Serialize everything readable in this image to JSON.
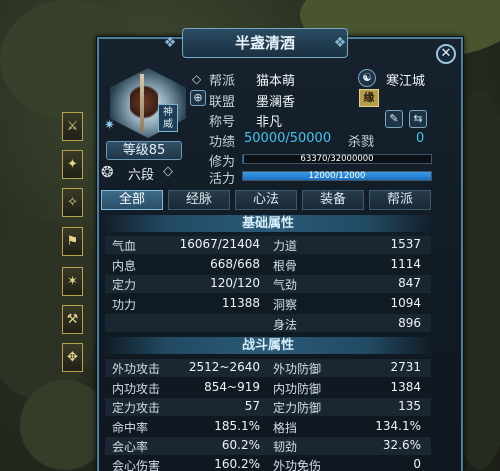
{
  "window": {
    "title": "半盏清酒"
  },
  "profile": {
    "level": "等级85",
    "school_badge": "神威",
    "rank": "六段",
    "guild_label": "帮派",
    "guild_value": "猫本萌",
    "city": "寒江城",
    "alliance_label": "联盟",
    "alliance_value": "墨澜香",
    "alliance_badge": "缘",
    "title_label": "称号",
    "title_value": "非凡",
    "merit_label": "功绩",
    "merit_value": "50000/50000",
    "kills_label": "杀戮",
    "kills_value": "0",
    "cultivation_label": "修为",
    "cultivation_text": "63370/32000000",
    "cultivation_fraction": 0.002,
    "vitality_label": "活力",
    "vitality_text": "12000/12000",
    "vitality_fraction": 1.0
  },
  "tabs": [
    {
      "label": "全部",
      "active": true
    },
    {
      "label": "经脉",
      "active": false
    },
    {
      "label": "心法",
      "active": false
    },
    {
      "label": "装备",
      "active": false
    },
    {
      "label": "帮派",
      "active": false
    }
  ],
  "basic": {
    "header": "基础属性",
    "left": [
      {
        "label": "气血",
        "value": "16067/21404"
      },
      {
        "label": "内息",
        "value": "668/668"
      },
      {
        "label": "定力",
        "value": "120/120"
      },
      {
        "label": "功力",
        "value": "11388"
      }
    ],
    "right": [
      {
        "label": "力道",
        "value": "1537"
      },
      {
        "label": "根骨",
        "value": "1114"
      },
      {
        "label": "气劲",
        "value": "847"
      },
      {
        "label": "洞察",
        "value": "1094"
      },
      {
        "label": "身法",
        "value": "896"
      }
    ]
  },
  "combat": {
    "header": "战斗属性",
    "left": [
      {
        "label": "外功攻击",
        "value": "2512~2640"
      },
      {
        "label": "内功攻击",
        "value": "854~919"
      },
      {
        "label": "定力攻击",
        "value": "57"
      },
      {
        "label": "命中率",
        "value": "185.1%"
      },
      {
        "label": "会心率",
        "value": "60.2%"
      },
      {
        "label": "会心伤害",
        "value": "160.2%"
      }
    ],
    "right": [
      {
        "label": "外功防御",
        "value": "2731"
      },
      {
        "label": "内功防御",
        "value": "1384"
      },
      {
        "label": "定力防御",
        "value": "135"
      },
      {
        "label": "格挡",
        "value": "134.1%"
      },
      {
        "label": "韧劲",
        "value": "32.6%"
      },
      {
        "label": "外功免伤",
        "value": "0"
      }
    ]
  },
  "colors": {
    "accent": "#43c4ec",
    "panel_border": "#4f7e9b",
    "bar_fill": "#1f78c8"
  },
  "icons": {
    "close": "close-icon",
    "portrait": "character-portrait",
    "star": "star-badge-icon",
    "rank": "rank-icon",
    "city": "city-icon",
    "alliance": "alliance-icon",
    "pen": "pen-icon",
    "compare": "compare-icon"
  }
}
